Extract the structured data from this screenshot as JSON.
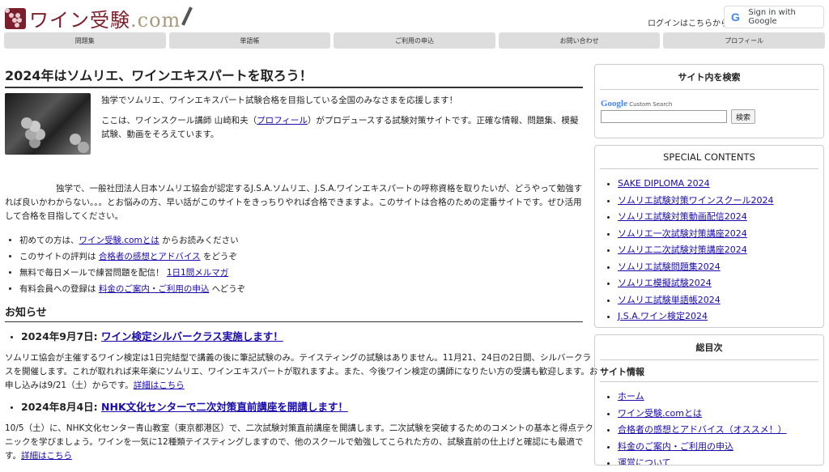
{
  "header": {
    "logo_text": "ワイン受験",
    "logo_com": ".com",
    "login_text": "ログインはこちらから",
    "google_signin": "Sign in with Google"
  },
  "nav": [
    "問題集",
    "単語帳",
    "ご利用の申込",
    "お問い合わせ",
    "プロフィール"
  ],
  "main": {
    "title": "2024年はソムリエ、ワインエキスパートを取ろう！",
    "intro1": "独学でソムリエ、ワインエキスパート試験合格を目指している全国のみなさまを応援します！",
    "intro2_pre": "ここは、ワインスクール講師 山崎和夫（",
    "intro2_link": "プロフィール",
    "intro2_post": "）がプロデュースする試験対策サイトです。正確な情報、問題集、模擬試験、動画をそろえています。",
    "intro3": "独学で、一般社団法人日本ソムリエ協会が認定するJ.S.A.ソムリエ、J.S.A.ワインエキスパートの呼称資格を取りたいが、どうやって勉強すれば良いかわからない。。。とお悩みの方、早い話がこのサイトをきっちりやれば合格できますよ。このサイトは合格のための定番サイトです。ぜひ活用して合格を目指してください。",
    "bullets": [
      {
        "pre": "初めての方は、",
        "link": "ワイン受験.comとは",
        "post": " からお読みください"
      },
      {
        "pre": "このサイトの評判は ",
        "link": "合格者の感想とアドバイス",
        "post": " をどうぞ"
      },
      {
        "pre": "無料で毎日メールで練習問題を配信！ ",
        "link": "1日1問メルマガ",
        "post": ""
      },
      {
        "pre": "有料会員への登録は ",
        "link": "料金のご案内・ご利用の申込",
        "post": " へどうぞ"
      }
    ],
    "news_heading": "お知らせ",
    "news": [
      {
        "date": "2024年9月7日: ",
        "title": "ワイン検定シルバークラス実施します！",
        "body": "ソムリエ協会が主催するワイン検定は1日完結型で講義の後に筆記試験のみ。テイスティングの試験はありません。11月21、24日の2日間、シルバークラスを開催します。これが取れれば来年楽にソムリエ、ワインエキスパートが取れますよ。また、今後ワイン検定の講師になりたい方の受講も歓迎します。お申し込みは9/21（土）からです。",
        "more": "詳細はこちら"
      },
      {
        "date": "2024年8月4日: ",
        "title": "NHK文化センターで二次対策直前講座を開講します！",
        "body": "10/5（土）に、NHK文化センター青山教室（東京都港区）で、二次試験対策直前講座を開講します。二次試験を突破するためのコメントの基本と得点テクニックを学びましょう。ワインを一気に12種類テイスティングしますので、他のスクールで勉強してこられた方の、試験直前の仕上げと確認にも最適です。",
        "more": "詳細はこちら"
      }
    ]
  },
  "sidebar": {
    "search_title": "サイト内を検索",
    "search_google": "Google",
    "search_custom": "Custom Search",
    "search_button": "検索",
    "special_title": "SPECIAL CONTENTS",
    "special_items": [
      "SAKE DIPLOMA 2024",
      "ソムリエ試験対策ワインスクール2024",
      "ソムリエ試験対策動画配信2024",
      "ソムリエ一次試験対策講座2024",
      "ソムリエ二次試験対策講座2024",
      "ソムリエ試験問題集2024",
      "ソムリエ模擬試験2024",
      "ソムリエ試験単語帳2024",
      "J.S.A.ワイン検定2024"
    ],
    "toc_title": "総目次",
    "toc_sub": "サイト情報",
    "toc_items": [
      "ホーム",
      "ワイン受験.comとは",
      "合格者の感想とアドバイス（オススメ！）",
      "料金のご案内・ご利用の申込",
      "運営について"
    ]
  }
}
